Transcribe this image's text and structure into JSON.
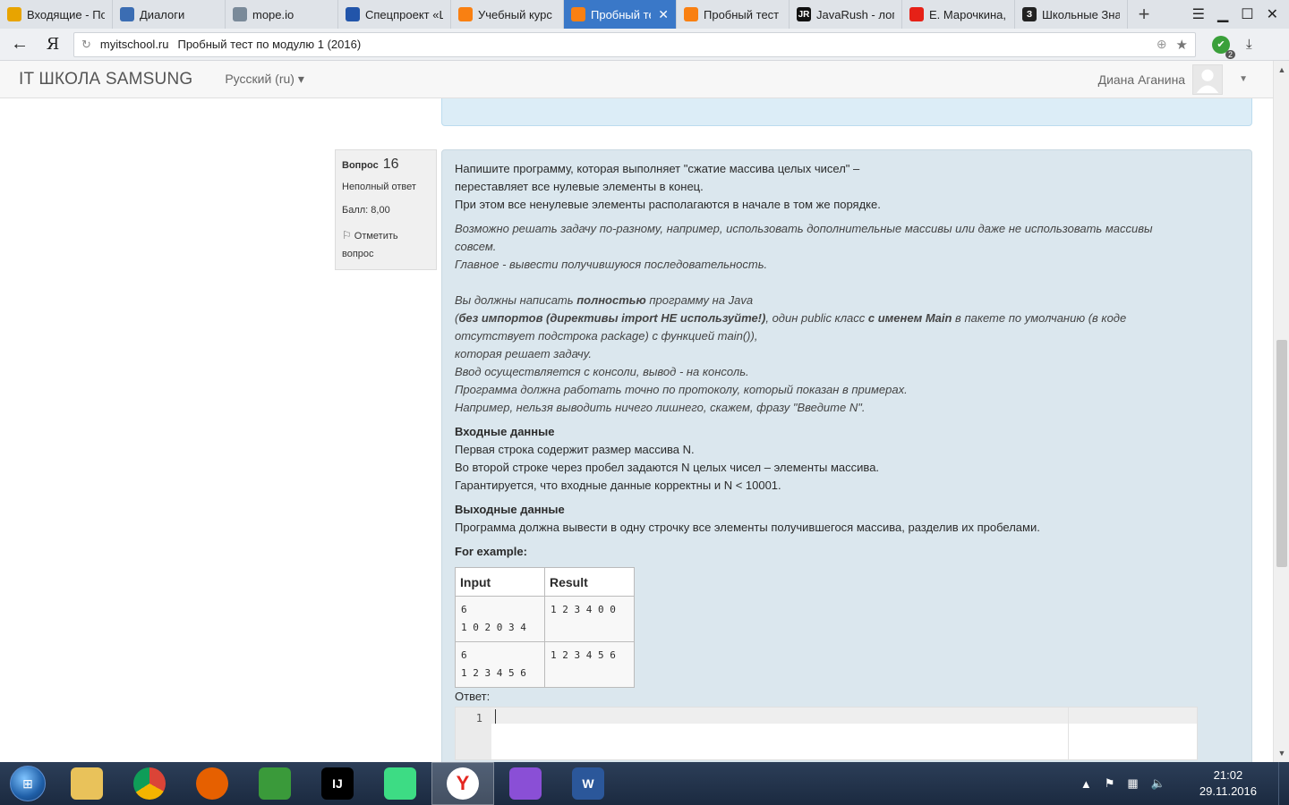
{
  "tabs": [
    {
      "label": "Входящие - По",
      "favicon": "mail-icon",
      "color": "#e8a400"
    },
    {
      "label": "Диалоги",
      "favicon": "chat-icon",
      "color": "#3b6db3"
    },
    {
      "label": "mope.io",
      "favicon": "globe-icon",
      "color": "#7a8a99"
    },
    {
      "label": "Спецпроект «Ш",
      "favicon": "project-icon",
      "color": "#2255aa"
    },
    {
      "label": "Учебный курс",
      "favicon": "moodle-icon",
      "color": "#f98012"
    },
    {
      "label": "Пробный те",
      "favicon": "moodle-icon",
      "color": "#f98012",
      "active": true
    },
    {
      "label": "Пробный тест",
      "favicon": "moodle-icon",
      "color": "#f98012"
    },
    {
      "label": "JavaRush - логи",
      "favicon": "javarush-icon",
      "color": "#111111",
      "badge": "JR"
    },
    {
      "label": "Е. Марочкина,",
      "favicon": "youtube-icon",
      "color": "#e62117"
    },
    {
      "label": "Школьные Зна",
      "favicon": "znanija-icon",
      "color": "#222222",
      "badge": "З"
    }
  ],
  "tab_close": "✕",
  "new_tab": "+",
  "address": {
    "host": "myitschool.ru",
    "title": "Пробный тест по модулю 1 (2016)",
    "ya": "Я",
    "shield_badge": "2"
  },
  "site": {
    "brand": "IT ШКОЛА SAMSUNG",
    "language": "Русский (ru)",
    "user_name": "Диана Аганина"
  },
  "question": {
    "label": "Вопрос",
    "number": "16",
    "state": "Неполный ответ",
    "grade": "Балл: 8,00",
    "flag_line1": "Отметить",
    "flag_line2": "вопрос"
  },
  "text": {
    "p1": "Напишите программу, которая выполняет \"сжатие массива целых чисел\" –",
    "p2": "переставляет все нулевые элементы в конец.",
    "p3": "При этом все ненулевые элементы располагаются в начале в том же порядке.",
    "i1": "Возможно решать задачу по-разному, например, использовать дополнительные массивы или даже не использовать массивы",
    "i2": "совсем.",
    "i3": "Главное - вывести получившуюся последовательность.",
    "i4a": "Вы должны написать ",
    "i4b": "полностью",
    "i4c": " программу на Java",
    "i5a": "(",
    "i5b": "без импортов (директивы import НЕ используйте!)",
    "i5c": ", один public класс ",
    "i5d": "с именем Main",
    "i5e": " в пакете по умолчанию (в коде",
    "i6": "отсутствует подстрока package) с функцией main()),",
    "i7": "которая решает задачу.",
    "i8": "Ввод осуществляется с консоли, вывод - на консоль.",
    "i9": "Программа должна работать точно по протоколу, который показан в примерах.",
    "i10": "Например, нельзя выводить ничего лишнего, скажем, фразу \"Введите N\".",
    "input_h": "Входные данные",
    "in1": "Первая строка содержит размер массива N.",
    "in2": "Во второй строке через пробел задаются N целых чисел – элементы массива.",
    "in3": "Гарантируется, что входные данные корректны и N < 10001.",
    "output_h": "Выходные данные",
    "out1": "Программа должна вывести в одну строчку все элементы получившегося массива, разделив их пробелами.",
    "example_h": "For example:"
  },
  "examples": {
    "head_input": "Input",
    "head_result": "Result",
    "rows": [
      {
        "input": "6\n1 0 2 0 3 4",
        "result": "1 2 3 4 0 0"
      },
      {
        "input": "6\n1 2 3 4 5 6",
        "result": "1 2 3 4 5 6"
      }
    ]
  },
  "answer": {
    "label": "Ответ:",
    "line_no": "1"
  },
  "taskbar": {
    "apps": [
      {
        "name": "explorer-icon",
        "color": "#e9c25a"
      },
      {
        "name": "chrome-icon",
        "color": "#db4437"
      },
      {
        "name": "firefox-icon",
        "color": "#e66000"
      },
      {
        "name": "rubik-icon",
        "color": "#3a9a3a"
      },
      {
        "name": "intellij-icon",
        "color": "#000000",
        "label": "IJ"
      },
      {
        "name": "android-studio-icon",
        "color": "#3ddc84"
      },
      {
        "name": "yandex-browser-icon",
        "color": "#ffffff",
        "label": "Y",
        "active": true
      },
      {
        "name": "app-icon",
        "color": "#8a4fd6"
      },
      {
        "name": "word-icon",
        "color": "#2b579a",
        "label": "W"
      }
    ],
    "time": "21:02",
    "date": "29.11.2016"
  }
}
